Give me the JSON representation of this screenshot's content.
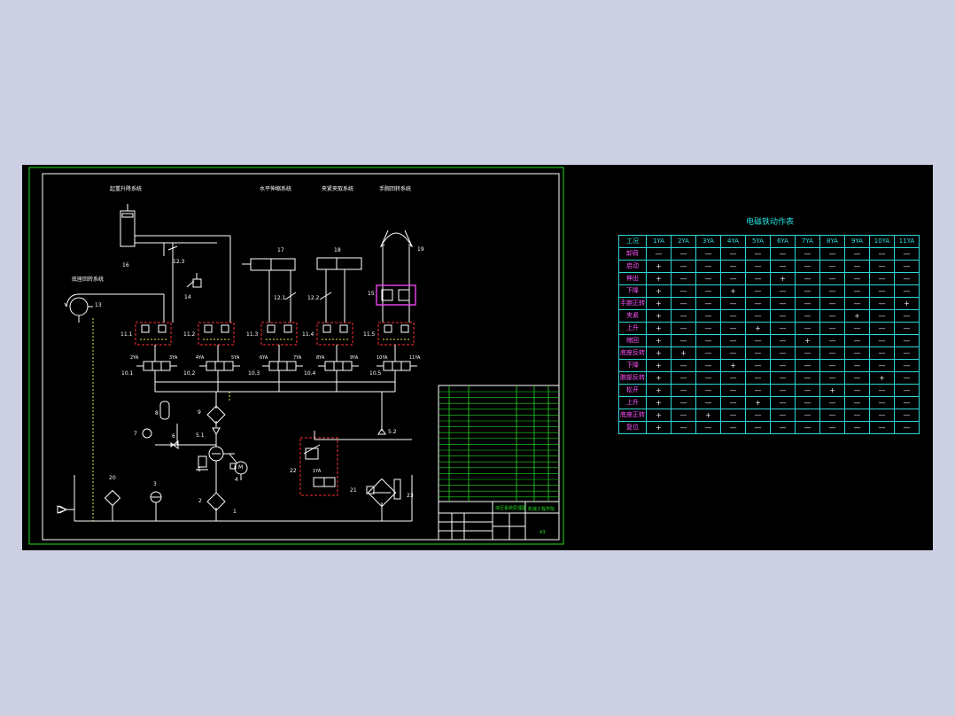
{
  "diagram": {
    "headings": {
      "lift": "起重升降系统",
      "horizontal": "水平伸缩系统",
      "clamp": "夹紧夹取系统",
      "wrist": "手腕回转系统",
      "base": "底座回转系统"
    },
    "component_labels": {
      "c16": "16",
      "c12_3": "12.3",
      "c14": "14",
      "c17": "17",
      "c18": "18",
      "c12_1": "12.1",
      "c12_2": "12.2",
      "c19": "19",
      "c15": "15",
      "c13": "13",
      "c11_1": "11.1",
      "c11_2": "11.2",
      "c11_3": "11.3",
      "c11_4": "11.4",
      "c11_5": "11.5",
      "c10_1": "10.1",
      "c10_2": "10.2",
      "c10_3": "10.3",
      "c10_4": "10.4",
      "c10_5": "10.5",
      "c9": "9",
      "c8": "8",
      "c7": "7",
      "c6": "6",
      "c5_1": "5.1",
      "c5_2": "5.2",
      "c5": "5",
      "c4": "4",
      "c3": "3",
      "c2": "2",
      "c1": "1",
      "c20": "20",
      "c21": "21",
      "c22": "22",
      "c23": "23"
    },
    "solenoids": {
      "s2": "2YA",
      "s3": "3YA",
      "s4": "4YA",
      "s5": "5YA",
      "s6": "6YA",
      "s7": "7YA",
      "s8": "8YA",
      "s9": "9YA",
      "s10": "10YA",
      "s11": "11YA",
      "s1": "1YA"
    },
    "motor": "M",
    "title_block": {
      "drawing_name": "液压系统原理图",
      "school": "机械工程学院",
      "sheet": "A3"
    }
  },
  "solenoid_table": {
    "title": "电磁铁动作表",
    "headers": [
      "工况",
      "1YA",
      "2YA",
      "3YA",
      "4YA",
      "5YA",
      "6YA",
      "7YA",
      "8YA",
      "9YA",
      "10YA",
      "11YA"
    ],
    "rows": [
      [
        "卸荷",
        "—",
        "—",
        "—",
        "—",
        "—",
        "—",
        "—",
        "—",
        "—",
        "—",
        "—"
      ],
      [
        "启动",
        "+",
        "—",
        "—",
        "—",
        "—",
        "—",
        "—",
        "—",
        "—",
        "—",
        "—"
      ],
      [
        "伸出",
        "+",
        "—",
        "—",
        "—",
        "—",
        "+",
        "—",
        "—",
        "—",
        "—",
        "—"
      ],
      [
        "下降",
        "+",
        "—",
        "—",
        "+",
        "—",
        "—",
        "—",
        "—",
        "—",
        "—",
        "—"
      ],
      [
        "手腕正转",
        "+",
        "—",
        "—",
        "—",
        "—",
        "—",
        "—",
        "—",
        "—",
        "—",
        "+"
      ],
      [
        "夹紧",
        "+",
        "—",
        "—",
        "—",
        "—",
        "—",
        "—",
        "—",
        "+",
        "—",
        "—"
      ],
      [
        "上升",
        "+",
        "—",
        "—",
        "—",
        "+",
        "—",
        "—",
        "—",
        "—",
        "—",
        "—"
      ],
      [
        "缩回",
        "+",
        "—",
        "—",
        "—",
        "—",
        "—",
        "+",
        "—",
        "—",
        "—",
        "—"
      ],
      [
        "底座反转",
        "+",
        "+",
        "—",
        "—",
        "—",
        "—",
        "—",
        "—",
        "—",
        "—",
        "—"
      ],
      [
        "下降",
        "+",
        "—",
        "—",
        "+",
        "—",
        "—",
        "—",
        "—",
        "—",
        "—",
        "—"
      ],
      [
        "腕部反转",
        "+",
        "—",
        "—",
        "—",
        "—",
        "—",
        "—",
        "—",
        "—",
        "+",
        "—"
      ],
      [
        "松开",
        "+",
        "—",
        "—",
        "—",
        "—",
        "—",
        "—",
        "+",
        "—",
        "—",
        "—"
      ],
      [
        "上升",
        "+",
        "—",
        "—",
        "—",
        "+",
        "—",
        "—",
        "—",
        "—",
        "—",
        "—"
      ],
      [
        "底座正转",
        "+",
        "—",
        "+",
        "—",
        "—",
        "—",
        "—",
        "—",
        "—",
        "—",
        "—"
      ],
      [
        "复位",
        "+",
        "—",
        "—",
        "—",
        "—",
        "—",
        "—",
        "—",
        "—",
        "—",
        "—"
      ]
    ]
  },
  "colors": {
    "background": "#cdcfe2",
    "canvas": "#000000",
    "frame": "#22dd22",
    "lines": "#ffffff",
    "dashed_red": "#ff3030",
    "dashed_yellow": "#e8e84a",
    "table": "#2fd6d6",
    "magenta": "#e040e0"
  }
}
